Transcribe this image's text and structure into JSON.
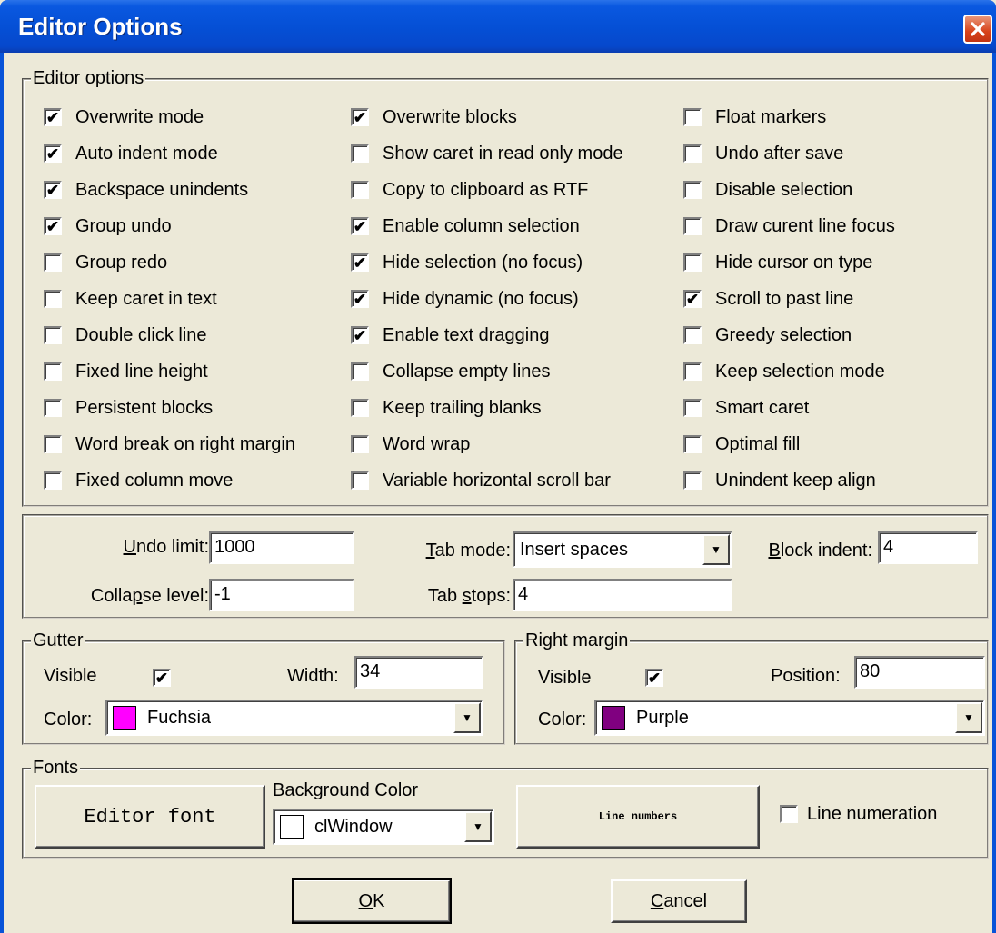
{
  "window": {
    "title": "Editor Options"
  },
  "editor_options": {
    "legend": "Editor options",
    "col1": [
      {
        "label": "Overwrite mode",
        "checked": true
      },
      {
        "label": "Auto indent mode",
        "checked": true
      },
      {
        "label": "Backspace unindents",
        "checked": true
      },
      {
        "label": "Group undo",
        "checked": true
      },
      {
        "label": "Group redo",
        "checked": false
      },
      {
        "label": "Keep caret in text",
        "checked": false
      },
      {
        "label": "Double click line",
        "checked": false
      },
      {
        "label": "Fixed line height",
        "checked": false
      },
      {
        "label": "Persistent blocks",
        "checked": false
      },
      {
        "label": "Word break on right margin",
        "checked": false
      },
      {
        "label": "Fixed column move",
        "checked": false
      }
    ],
    "col2": [
      {
        "label": "Overwrite blocks",
        "checked": true
      },
      {
        "label": "Show caret in read only mode",
        "checked": false
      },
      {
        "label": "Copy to clipboard as RTF",
        "checked": false
      },
      {
        "label": "Enable column selection",
        "checked": true
      },
      {
        "label": "Hide selection (no focus)",
        "checked": true
      },
      {
        "label": "Hide dynamic (no focus)",
        "checked": true
      },
      {
        "label": "Enable text dragging",
        "checked": true
      },
      {
        "label": "Collapse empty lines",
        "checked": false
      },
      {
        "label": "Keep trailing blanks",
        "checked": false
      },
      {
        "label": "Word wrap",
        "checked": false
      },
      {
        "label": "Variable horizontal scroll bar",
        "checked": false
      }
    ],
    "col3": [
      {
        "label": "Float markers",
        "checked": false
      },
      {
        "label": "Undo after save",
        "checked": false
      },
      {
        "label": "Disable selection",
        "checked": false
      },
      {
        "label": "Draw curent line focus",
        "checked": false
      },
      {
        "label": "Hide cursor on type",
        "checked": false
      },
      {
        "label": "Scroll to past line",
        "checked": true
      },
      {
        "label": "Greedy selection",
        "checked": false
      },
      {
        "label": "Keep selection mode",
        "checked": false
      },
      {
        "label": "Smart caret",
        "checked": false
      },
      {
        "label": "Optimal fill",
        "checked": false
      },
      {
        "label": "Unindent keep align",
        "checked": false
      }
    ]
  },
  "settings": {
    "undo_limit": {
      "label_u": "U",
      "label_rest": "ndo limit:",
      "value": "1000"
    },
    "collapse_level": {
      "label_pre": "Colla",
      "label_u": "p",
      "label_rest": "se level:",
      "value": "-1"
    },
    "tab_mode": {
      "label_u": "T",
      "label_rest": "ab mode:",
      "value": "Insert spaces"
    },
    "tab_stops": {
      "label_pre": "Tab ",
      "label_u": "s",
      "label_rest": "tops:",
      "value": "4"
    },
    "block_indent": {
      "label_u": "B",
      "label_rest": "lock indent:",
      "value": "4"
    }
  },
  "gutter": {
    "legend": "Gutter",
    "visible_label": "Visible",
    "visible_checked": true,
    "width_label": "Width:",
    "width_value": "34",
    "color_label": "Color:",
    "color_name": "Fuchsia",
    "color_hex": "#ff00ff"
  },
  "right_margin": {
    "legend": "Right margin",
    "visible_label": "Visible",
    "visible_checked": true,
    "position_label": "Position:",
    "position_value": "80",
    "color_label": "Color:",
    "color_name": "Purple",
    "color_hex": "#800080"
  },
  "fonts": {
    "legend": "Fonts",
    "editor_font_button": "Editor font",
    "background_color_label": "Background Color",
    "background_color_name": "clWindow",
    "background_color_hex": "#ffffff",
    "line_numbers_button": "Line numbers",
    "line_numeration_label": "Line numeration",
    "line_numeration_checked": false
  },
  "buttons": {
    "ok_u": "O",
    "ok_rest": "K",
    "cancel_u": "C",
    "cancel_rest": "ancel"
  }
}
